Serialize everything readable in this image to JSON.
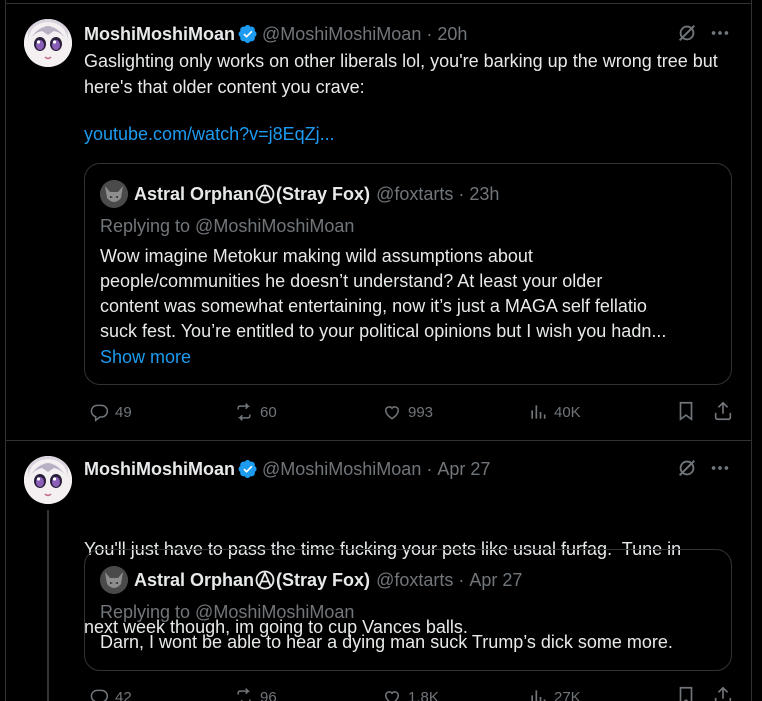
{
  "tweets": [
    {
      "author_name": "MoshiMoshiMoan",
      "author_handle": "@MoshiMoshiMoan",
      "dot": "·",
      "time": "20h",
      "text": "Gaslighting only works on other liberals lol, you're barking up the wrong tree but here's that older content you crave:",
      "link": "youtube.com/watch?v=j8EqZj...",
      "quote": {
        "name_part1": "Astral Orphan",
        "name_part2": "(Stray Fox)",
        "handle": "@foxtarts",
        "dot": "·",
        "time": "23h",
        "replying": "Replying to @MoshiMoshiMoan",
        "text_lines": [
          "Wow imagine Metokur making wild assumptions about",
          "people/communities he doesn’t understand? At least your older",
          "content was somewhat entertaining, now it’s just a MAGA self fellatio",
          "suck fest. You’re entitled to your political opinions but I wish you hadn..."
        ],
        "show_more": "Show more"
      },
      "stats": {
        "replies": "49",
        "reposts": "60",
        "likes": "993",
        "views": "40K"
      }
    },
    {
      "author_name": "MoshiMoshiMoan",
      "author_handle": "@MoshiMoshiMoan",
      "dot": "·",
      "time": "Apr 27",
      "text_lines": [
        "You'll just have to pass the time fucking your pets like usual furfag.  Tune in",
        "next week though, im going to cup Vances balls."
      ],
      "quote": {
        "name_part1": "Astral Orphan",
        "name_part2": "(Stray Fox)",
        "handle": "@foxtarts",
        "dot": "·",
        "time": "Apr 27",
        "replying": "Replying to @MoshiMoshiMoan",
        "text": "Darn, I wont be able to hear a dying man suck Trump’s dick some more."
      },
      "stats": {
        "replies": "42",
        "reposts": "96",
        "likes": "1.8K",
        "views": "27K"
      }
    }
  ],
  "icons": [
    "verified-badge-icon",
    "grok-icon",
    "more-icon",
    "reply-icon",
    "repost-icon",
    "like-icon",
    "views-icon",
    "bookmark-icon",
    "share-icon",
    "anarchy-symbol-icon"
  ],
  "colors": {
    "background": "#000000",
    "text": "#e7e9ea",
    "muted": "#71767b",
    "link": "#1d9bf0",
    "border": "#2f3336",
    "verified": "#1d9bf0"
  }
}
